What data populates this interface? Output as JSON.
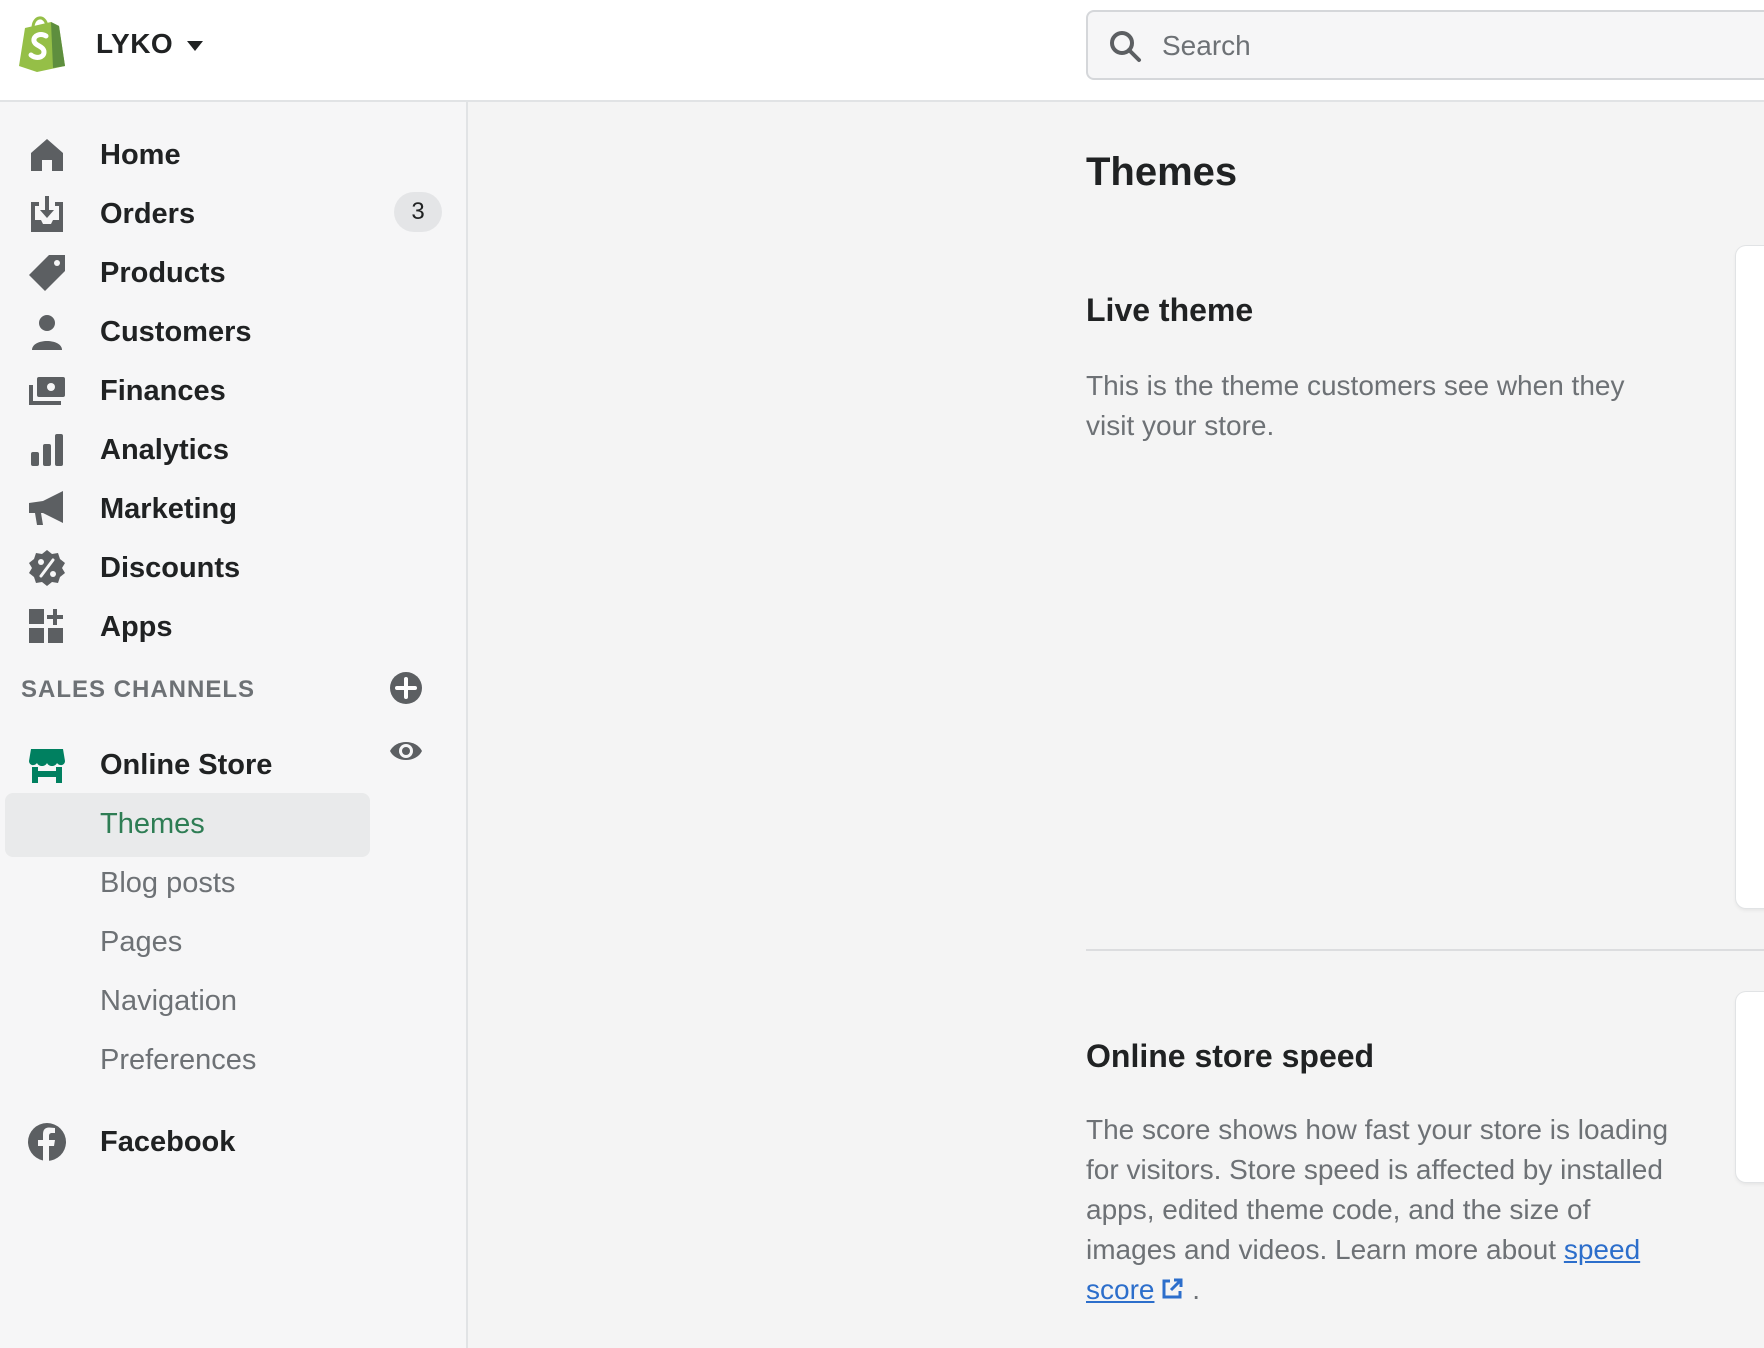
{
  "header": {
    "store_name": "LYKO",
    "search_placeholder": "Search"
  },
  "sidebar": {
    "items": [
      {
        "label": "Home",
        "icon": "home-icon"
      },
      {
        "label": "Orders",
        "icon": "orders-icon",
        "badge": "3"
      },
      {
        "label": "Products",
        "icon": "tag-icon"
      },
      {
        "label": "Customers",
        "icon": "person-icon"
      },
      {
        "label": "Finances",
        "icon": "finances-icon"
      },
      {
        "label": "Analytics",
        "icon": "bar-chart-icon"
      },
      {
        "label": "Marketing",
        "icon": "megaphone-icon"
      },
      {
        "label": "Discounts",
        "icon": "discount-icon"
      },
      {
        "label": "Apps",
        "icon": "apps-icon"
      }
    ],
    "sales_channels_heading": "SALES CHANNELS",
    "online_store": {
      "label": "Online Store",
      "sub_items": [
        {
          "label": "Themes",
          "active": true
        },
        {
          "label": "Blog posts"
        },
        {
          "label": "Pages"
        },
        {
          "label": "Navigation"
        },
        {
          "label": "Preferences"
        }
      ]
    },
    "facebook": {
      "label": "Facebook"
    }
  },
  "main": {
    "title": "Themes",
    "live_theme": {
      "title": "Live theme",
      "description": "This is the theme customers see when they visit your store."
    },
    "speed": {
      "title": "Online store speed",
      "description": "The score shows how fast your store is loading for visitors. Store speed is affected by installed apps, edited theme code, and the size of images and videos. Learn more about",
      "link_text": "speed score",
      "trailing": "."
    }
  },
  "colors": {
    "accent_green": "#2e7d54",
    "brand_green": "#95bf47",
    "link_blue": "#2c6ecb",
    "online_store_icon": "#008060"
  }
}
